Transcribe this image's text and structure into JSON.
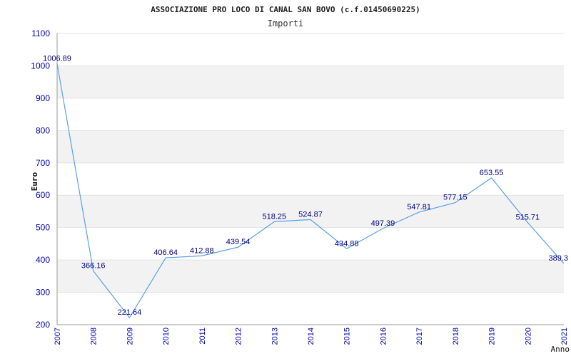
{
  "chart_data": {
    "type": "line",
    "title": "ASSOCIAZIONE PRO LOCO DI CANAL SAN BOVO (c.f.01450690225)",
    "subtitle": "Importi",
    "xlabel": "Anno",
    "ylabel": "Euro",
    "ylim": [
      200,
      1100
    ],
    "yticks": [
      "200",
      "300",
      "400",
      "500",
      "600",
      "700",
      "800",
      "900",
      "1000",
      "1100"
    ],
    "grid": true,
    "colors": {
      "line": "#5aa0e6",
      "band": "#f2f2f2",
      "tick": "#0000aa",
      "label": "#000080"
    },
    "series": [
      {
        "x": [
          "2007",
          "2008",
          "2009",
          "2010",
          "2011",
          "2012",
          "2013",
          "2014",
          "2015",
          "2016",
          "2017",
          "2018",
          "2019",
          "2020",
          "2021"
        ],
        "values": [
          1006.89,
          366.16,
          221.64,
          406.64,
          412.88,
          439.54,
          518.25,
          524.87,
          434.88,
          497.39,
          547.81,
          577.15,
          653.55,
          515.71,
          389.3
        ],
        "labels": [
          "1006.89",
          "366.16",
          "221.64",
          "406.64",
          "412.88",
          "439.54",
          "518.25",
          "524.87",
          "434.88",
          "497.39",
          "547.81",
          "577.15",
          "653.55",
          "515.71",
          "389.3"
        ]
      }
    ]
  }
}
